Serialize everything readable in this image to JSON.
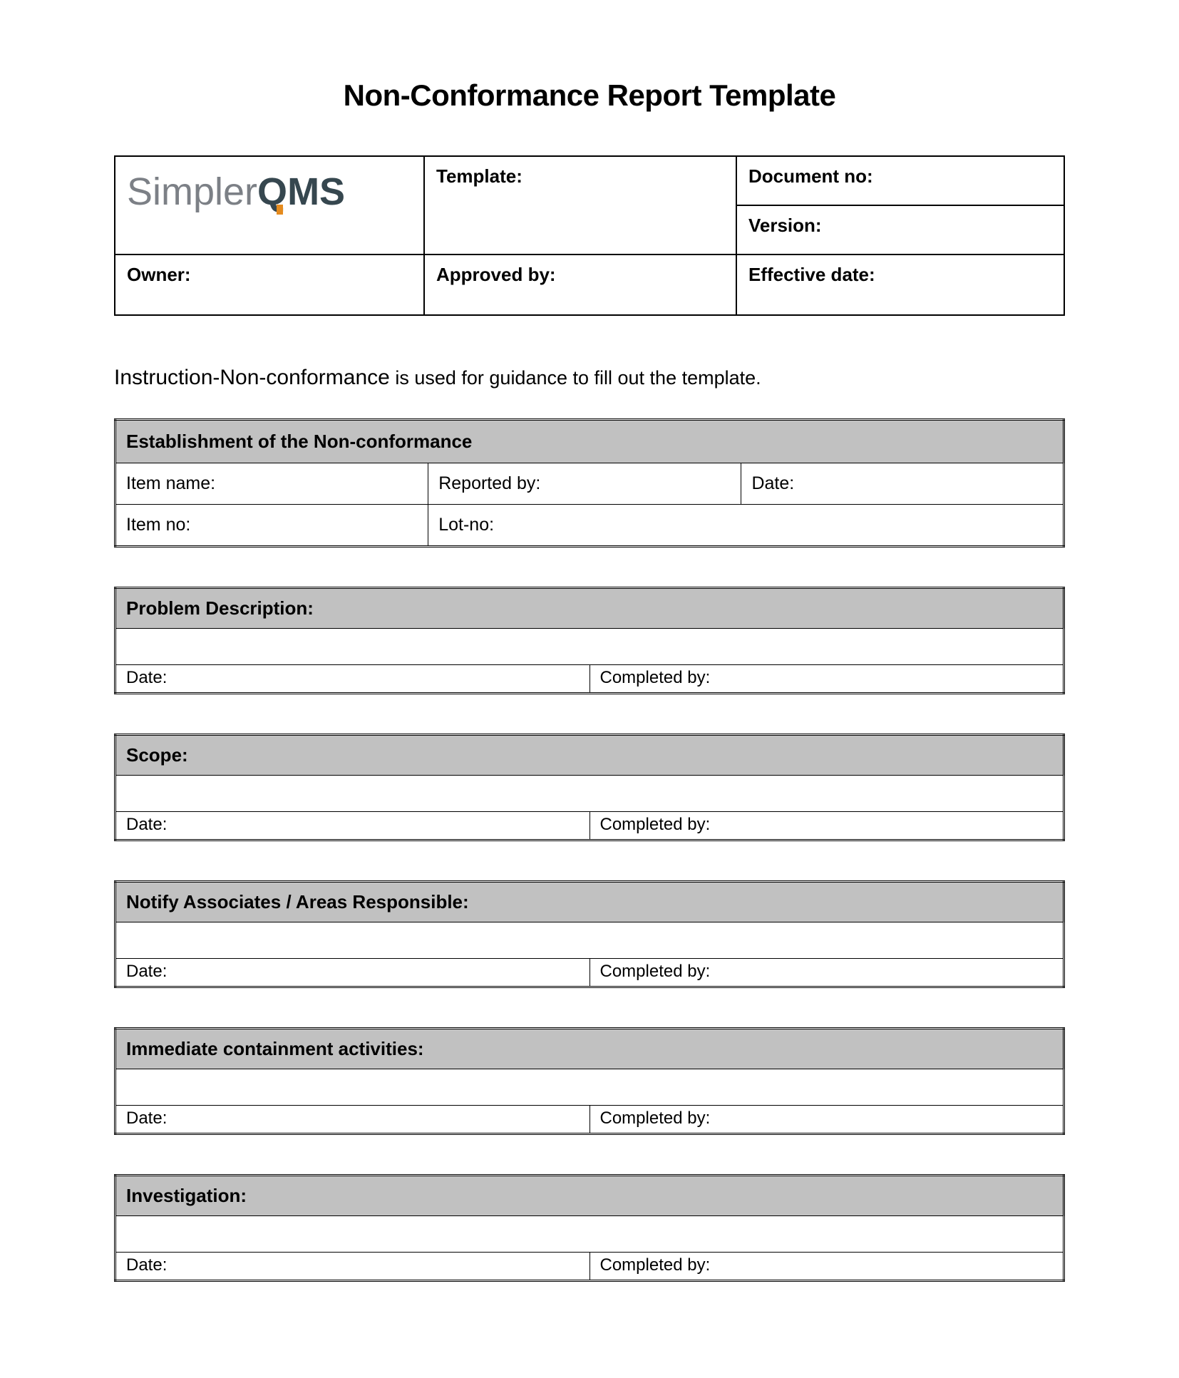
{
  "title": "Non-Conformance Report Template",
  "logo": {
    "part1": "Simpler",
    "part2": "Q",
    "part3": "MS"
  },
  "header": {
    "template_label": "Template:",
    "document_no_label": "Document no:",
    "version_label": "Version:",
    "owner_label": "Owner:",
    "approved_by_label": "Approved by:",
    "effective_date_label": "Effective date:"
  },
  "instruction": {
    "lead": "Instruction-Non-conformance",
    "rest": " is used for guidance to fill out the template."
  },
  "establishment": {
    "heading": "Establishment of the Non-conformance",
    "item_name": "Item name:",
    "reported_by": "Reported by:",
    "date": "Date:",
    "item_no": "Item no:",
    "lot_no": "Lot-no:"
  },
  "sections": {
    "problem": {
      "title": "Problem Description:",
      "date": "Date:",
      "completed": "Completed by:"
    },
    "scope": {
      "title": "Scope:",
      "date": "Date:",
      "completed": "Completed by:"
    },
    "notify": {
      "title": "Notify Associates / Areas Responsible:",
      "date": "Date:",
      "completed": "Completed by:"
    },
    "contain": {
      "title": "Immediate containment activities:",
      "date": "Date:",
      "completed": "Completed by:"
    },
    "investig": {
      "title": "Investigation:",
      "date": "Date:",
      "completed": "Completed by:"
    }
  }
}
